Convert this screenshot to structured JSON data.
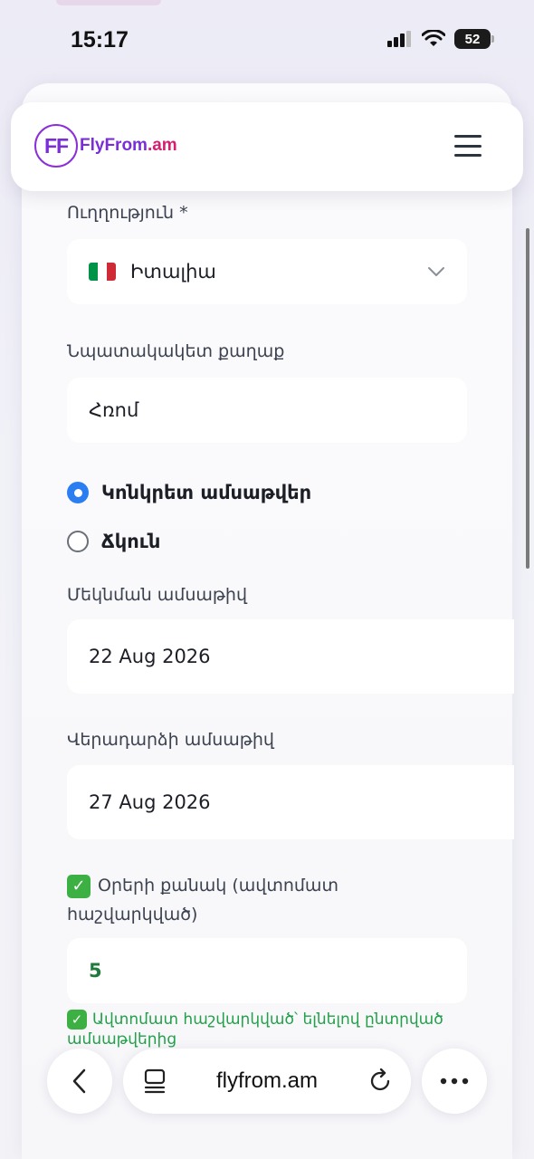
{
  "status": {
    "time": "15:17",
    "battery": "52"
  },
  "header": {
    "logo_mark": "FF",
    "logo_name": "FlyFrom",
    "logo_tld": ".am",
    "menu_icon": "hamburger-icon"
  },
  "form": {
    "direction_label": "Ուղղություն *",
    "direction_value": "Իտալիա",
    "direction_flag_colors": [
      "#009246",
      "#ffffff",
      "#ce2b37"
    ],
    "city_label": "Նպատակակետ քաղաք",
    "city_value": "Հռոմ",
    "date_options": [
      {
        "label": "Կոնկրետ ամսաթվեր",
        "selected": true
      },
      {
        "label": "Ճկուն",
        "selected": false
      }
    ],
    "departure_label": "Մեկնման ամսաթիվ",
    "departure_value": "22 Aug 2026",
    "return_label": "Վերադարձի ամսաթիվ",
    "return_value": "27 Aug 2026",
    "days_label": "Օրերի քանակ (ավտոմատ հաշվարկված)",
    "days_value": "5",
    "auto_note": "Ավտոմատ հաշվարկված՝ ելնելով ընտրված ամսաթվերից"
  },
  "browser": {
    "url": "flyfrom.am"
  }
}
